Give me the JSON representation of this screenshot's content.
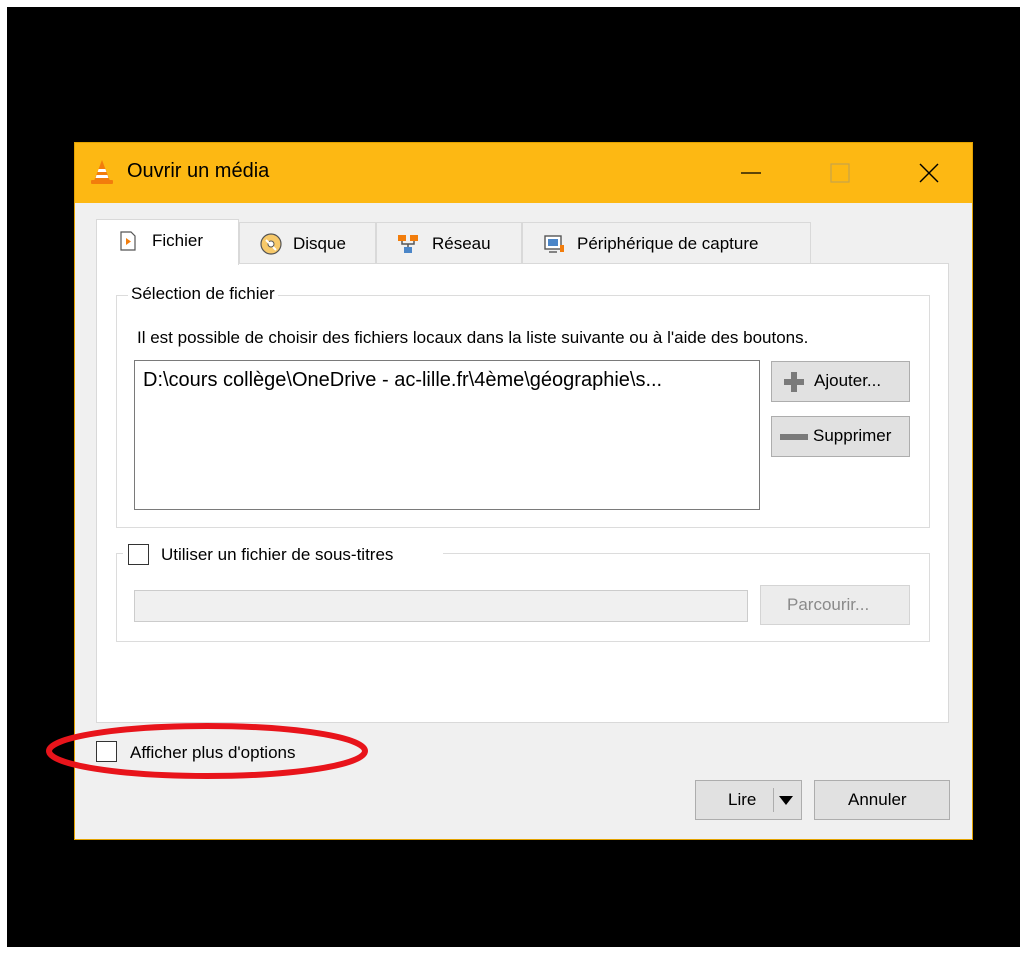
{
  "window": {
    "title": "Ouvrir un média",
    "accent_color": "#fdb813",
    "controls": [
      "minimize-icon",
      "maximize-icon",
      "close-icon"
    ]
  },
  "tabs": [
    {
      "label": "Fichier",
      "icon": "file-play-icon",
      "active": true
    },
    {
      "label": "Disque",
      "icon": "disc-icon",
      "active": false
    },
    {
      "label": "Réseau",
      "icon": "network-icon",
      "active": false
    },
    {
      "label": "Périphérique de capture",
      "icon": "capture-device-icon",
      "active": false
    }
  ],
  "file_selection": {
    "group_title": "Sélection de fichier",
    "description": "Il est possible de choisir des fichiers locaux dans la liste suivante ou à l'aide des boutons.",
    "files": [
      "D:\\cours collège\\OneDrive - ac-lille.fr\\4ème\\géographie\\s..."
    ],
    "add_button": "Ajouter...",
    "remove_button": "Supprimer"
  },
  "subtitles": {
    "checkbox_label": "Utiliser un fichier de sous-titres",
    "checked": false,
    "path_value": "",
    "browse_button": "Parcourir..."
  },
  "more_options": {
    "label": "Afficher plus d'options",
    "checked": false,
    "highlight_color": "#e8141b"
  },
  "footer": {
    "play_button": "Lire",
    "cancel_button": "Annuler"
  }
}
